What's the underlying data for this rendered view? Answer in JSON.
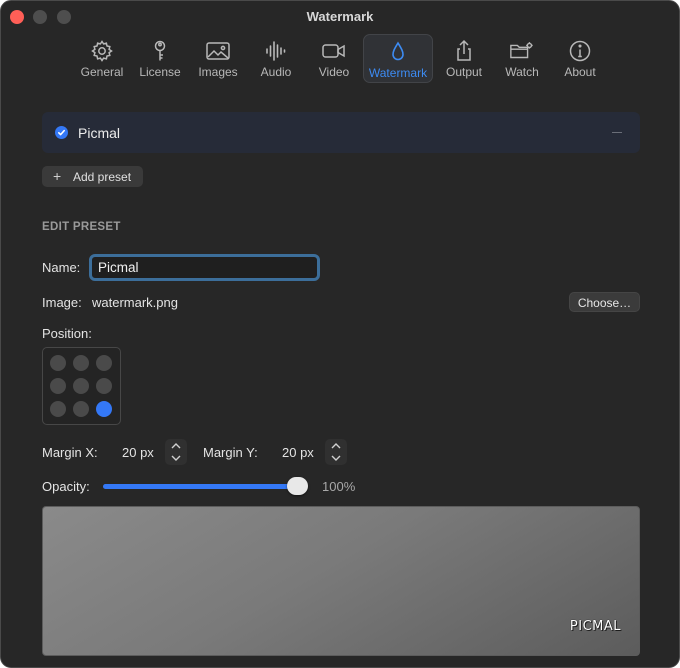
{
  "window": {
    "title": "Watermark"
  },
  "toolbar": {
    "tabs": [
      {
        "label": "General",
        "icon": "gear-icon"
      },
      {
        "label": "License",
        "icon": "key-icon"
      },
      {
        "label": "Images",
        "icon": "photo-icon"
      },
      {
        "label": "Audio",
        "icon": "waveform-icon"
      },
      {
        "label": "Video",
        "icon": "video-camera-icon"
      },
      {
        "label": "Watermark",
        "icon": "drop-icon",
        "active": true
      },
      {
        "label": "Output",
        "icon": "share-icon"
      },
      {
        "label": "Watch",
        "icon": "folder-gear-icon"
      },
      {
        "label": "About",
        "icon": "info-icon"
      }
    ]
  },
  "presets": {
    "items": [
      {
        "name": "Picmal",
        "selected": true
      }
    ],
    "add_label": "Add preset"
  },
  "edit": {
    "heading": "EDIT PRESET",
    "name_label": "Name:",
    "name_value": "Picmal",
    "image_label": "Image:",
    "image_value": "watermark.png",
    "choose_label": "Choose…",
    "position_label": "Position:",
    "position_selected": "bottom-right",
    "margin_x_label": "Margin X:",
    "margin_x_value": "20 px",
    "margin_y_label": "Margin Y:",
    "margin_y_value": "20 px",
    "opacity_label": "Opacity:",
    "opacity_value": "100%",
    "opacity_fraction": 1.0
  },
  "preview": {
    "watermark_text": "PICMAL"
  },
  "colors": {
    "accent": "#3478f6",
    "accent_text": "#3d8bf2",
    "window_bg": "#272727"
  }
}
